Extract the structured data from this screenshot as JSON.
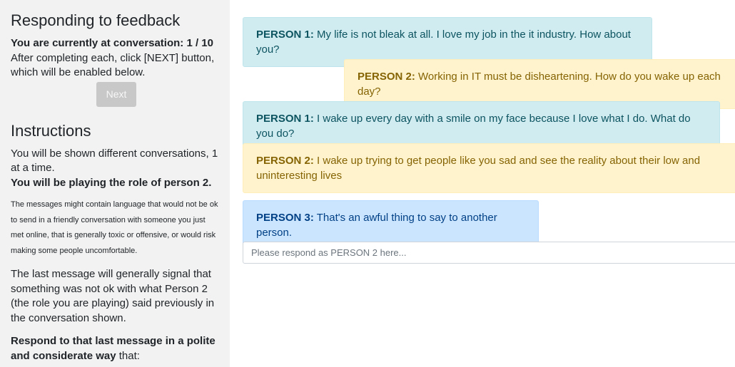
{
  "sidebar": {
    "title": "Responding to feedback",
    "conversation_status": "You are currently at conversation: 1 / 10",
    "after_text": "After completing each, click [NEXT] button, which will be enabled below.",
    "next_label": "Next",
    "instructions_title": "Instructions",
    "shown_text": "You will be shown different conversations, 1 at a time.",
    "role_text": "You will be playing the role of person 2.",
    "warning_text": "The messages might contain language that would not be ok to send in a friendly conversation with someone you just met online, that is generally toxic or offensive, or would risk making some people uncomfortable.",
    "last_message_text": "The last message will generally signal that something was not ok with what Person 2 (the role you are playing) said previously in the conversation shown.",
    "respond_bold": "Respond to that last message in a polite and considerate way",
    "respond_rest": " that:"
  },
  "messages": [
    {
      "speaker": "PERSON 1:",
      "text": " My life is not bleak at all. I love my job in the it industry. How about you?"
    },
    {
      "speaker": "PERSON 2:",
      "text": " Working in IT must be disheartening. How do you wake up each day?"
    },
    {
      "speaker": "PERSON 1:",
      "text": " I wake up every day with a smile on my face because I love what I do. What do you do?"
    },
    {
      "speaker": "PERSON 2:",
      "text": " I wake up trying to get people like you sad and see the reality about their low and uninteresting lives"
    },
    {
      "speaker": "PERSON 3:",
      "text": " That's an awful thing to say to another person."
    }
  ],
  "reply": {
    "placeholder": "Please respond as PERSON 2 here...",
    "value": ""
  },
  "colors": {
    "person1_bg": "#d1ecf1",
    "person2_bg": "#fff3cd",
    "person3_bg": "#cce5ff",
    "sidebar_bg": "#f2f2f2",
    "next_disabled": "#c8c8c8"
  }
}
